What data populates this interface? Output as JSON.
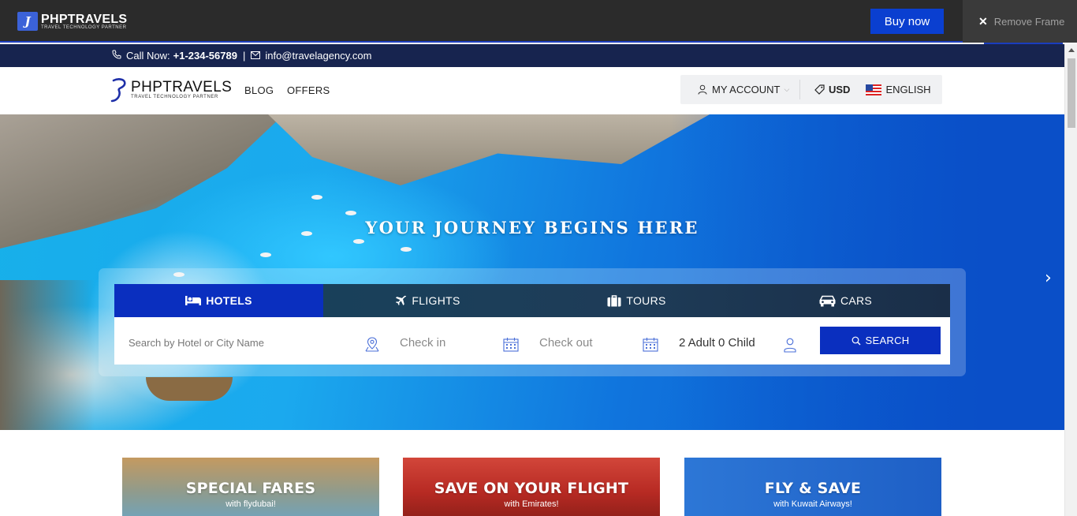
{
  "frame": {
    "logo_mark": "J",
    "logo_name": "PHPTRAVELS",
    "logo_tagline": "TRAVEL TECHNOLOGY PARTNER",
    "buy_now": "Buy now",
    "remove_frame": "Remove Frame"
  },
  "contact": {
    "call_label": "Call Now:",
    "phone": "+1-234-56789",
    "separator": "|",
    "email": "info@travelagency.com"
  },
  "nav": {
    "logo_name": "PHPTRAVELS",
    "logo_tagline": "TRAVEL TECHNOLOGY PARTNER",
    "links": [
      "BLOG",
      "OFFERS"
    ],
    "account": "MY ACCOUNT",
    "currency": "USD",
    "language": "ENGLISH"
  },
  "hero": {
    "title": "YOUR JOURNEY BEGINS HERE",
    "next_glyph": "›"
  },
  "search": {
    "tabs": [
      "HOTELS",
      "FLIGHTS",
      "TOURS",
      "CARS"
    ],
    "active_tab": "HOTELS",
    "destination_placeholder": "Search by Hotel or City Name",
    "checkin": "Check in",
    "checkout": "Check out",
    "guests": "2 Adult 0 Child",
    "search_button": "SEARCH"
  },
  "deals": [
    {
      "title": "SPECIAL FARES",
      "subtitle": "with flydubai!"
    },
    {
      "title": "SAVE ON YOUR FLIGHT",
      "subtitle": "with Emirates!"
    },
    {
      "title": "FLY & SAVE",
      "subtitle": "with Kuwait Airways!"
    }
  ],
  "colors": {
    "brand_blue": "#0a2fbf",
    "contact_strip": "#17244f",
    "frame_bar": "#2b2b2b"
  },
  "icons": [
    "x-icon",
    "phone-icon",
    "envelope-icon",
    "user-icon",
    "chevron-down-icon",
    "tag-icon",
    "us-flag-icon",
    "bed-icon",
    "plane-icon",
    "suitcase-icon",
    "car-icon",
    "map-pin-icon",
    "calendar-icon",
    "search-icon",
    "chevron-right-icon"
  ]
}
